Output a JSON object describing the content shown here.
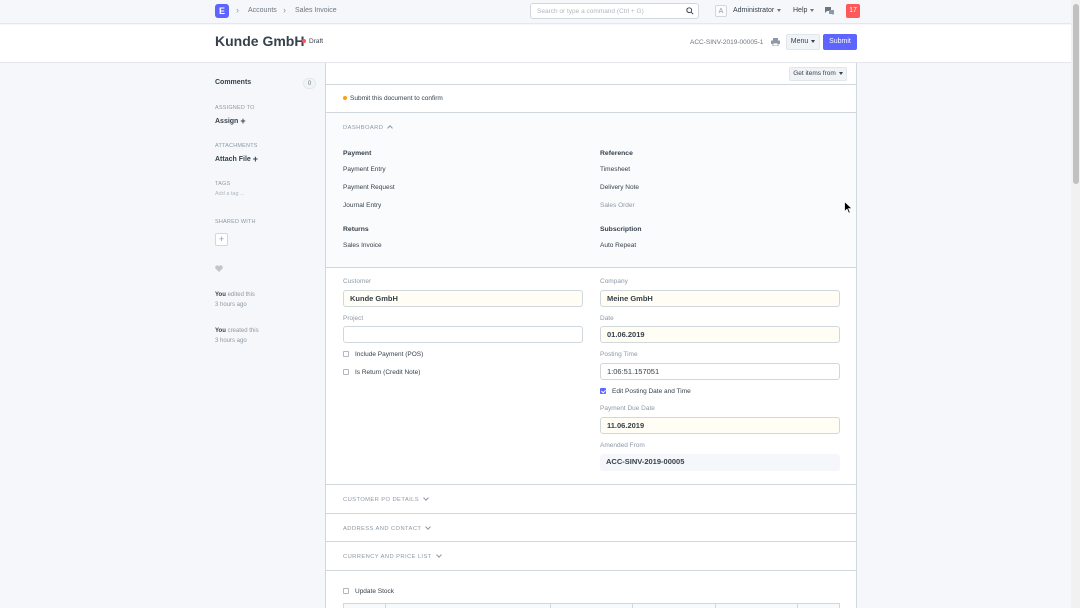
{
  "navbar": {
    "logo_letter": "E",
    "breadcrumbs": [
      "Accounts",
      "Sales Invoice"
    ],
    "search_placeholder": "Search or type a command (Ctrl + G)",
    "avatar_letter": "A",
    "user_label": "Administrator",
    "help_label": "Help",
    "notification_count": "17"
  },
  "page": {
    "title": "Kunde GmbH",
    "status": "Draft",
    "doc_name": "ACC-SINV-2019-00005-1",
    "menu_label": "Menu",
    "submit_label": "Submit"
  },
  "sidebar": {
    "comments_label": "Comments",
    "comments_count": "0",
    "assigned_to_label": "ASSIGNED TO",
    "assign_label": "Assign",
    "attachments_label": "ATTACHMENTS",
    "attach_file_label": "Attach File",
    "tags_label": "TAGS",
    "add_tag_label": "Add a tag ...",
    "shared_with_label": "SHARED WITH",
    "activity": [
      {
        "who": "You",
        "what": "edited this",
        "when": "3 hours ago"
      },
      {
        "who": "You",
        "what": "created this",
        "when": "3 hours ago"
      }
    ]
  },
  "form": {
    "get_items_label": "Get items from",
    "confirm_message": "Submit this document to confirm",
    "dashboard": {
      "heading": "DASHBOARD",
      "groups": [
        {
          "title": "Payment",
          "links": [
            "Payment Entry",
            "Payment Request",
            "Journal Entry"
          ]
        },
        {
          "title": "Reference",
          "links": [
            "Timesheet",
            "Delivery Note",
            "Sales Order"
          ]
        },
        {
          "title": "Returns",
          "links": [
            "Sales Invoice"
          ]
        },
        {
          "title": "Subscription",
          "links": [
            "Auto Repeat"
          ]
        }
      ]
    },
    "fields": {
      "customer_label": "Customer",
      "customer_value": "Kunde GmbH",
      "project_label": "Project",
      "project_value": "",
      "include_payment_label": "Include Payment (POS)",
      "is_return_label": "Is Return (Credit Note)",
      "company_label": "Company",
      "company_value": "Meine GmbH",
      "date_label": "Date",
      "date_value": "01.06.2019",
      "posting_time_label": "Posting Time",
      "posting_time_value": "1:06:51.157051",
      "edit_posting_label": "Edit Posting Date and Time",
      "edit_posting_checked": true,
      "due_date_label": "Payment Due Date",
      "due_date_value": "11.06.2019",
      "amended_from_label": "Amended From",
      "amended_from_value": "ACC-SINV-2019-00005"
    },
    "sections": [
      "CUSTOMER PO DETAILS",
      "ADDRESS AND CONTACT",
      "CURRENCY AND PRICE LIST"
    ],
    "update_stock_label": "Update Stock"
  }
}
